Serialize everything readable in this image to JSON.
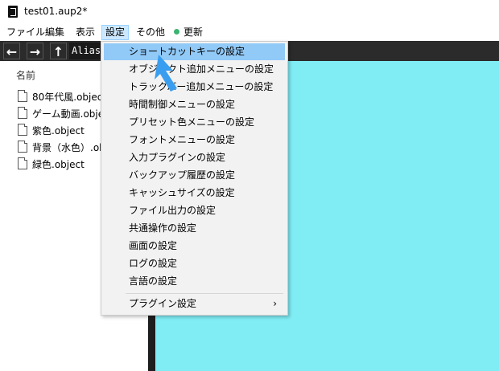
{
  "window": {
    "title": "test01.aup2*"
  },
  "menubar": {
    "items": [
      {
        "label": "ファイル"
      },
      {
        "label": "編集"
      },
      {
        "label": "表示"
      },
      {
        "label": "設定"
      },
      {
        "label": "その他"
      },
      {
        "label": "更新"
      }
    ]
  },
  "toolbar": {
    "path_text": "Alias"
  },
  "leftpanel": {
    "column_header": "名前",
    "files": [
      {
        "label": "80年代風.object"
      },
      {
        "label": "ゲーム動画.object"
      },
      {
        "label": "紫色.object"
      },
      {
        "label": "背景（水色）.object"
      },
      {
        "label": "緑色.object"
      }
    ]
  },
  "settings_menu": {
    "items": [
      {
        "label": "ショートカットキーの設定"
      },
      {
        "label": "オブジェクト追加メニューの設定"
      },
      {
        "label": "トラックバー追加メニューの設定"
      },
      {
        "label": "時間制御メニューの設定"
      },
      {
        "label": "プリセット色メニューの設定"
      },
      {
        "label": "フォントメニューの設定"
      },
      {
        "label": "入力プラグインの設定"
      },
      {
        "label": "バックアップ履歴の設定"
      },
      {
        "label": "キャッシュサイズの設定"
      },
      {
        "label": "ファイル出力の設定"
      },
      {
        "label": "共通操作の設定"
      },
      {
        "label": "画面の設定"
      },
      {
        "label": "ログの設定"
      },
      {
        "label": "言語の設定"
      }
    ],
    "plugin_item": {
      "label": "プラグイン設定",
      "arrow": "›"
    }
  },
  "colors": {
    "highlight": "#91c9f7",
    "preview_bg": "#80edf5",
    "cursor": "#3a9ef0",
    "status_dot": "#3cb371"
  }
}
